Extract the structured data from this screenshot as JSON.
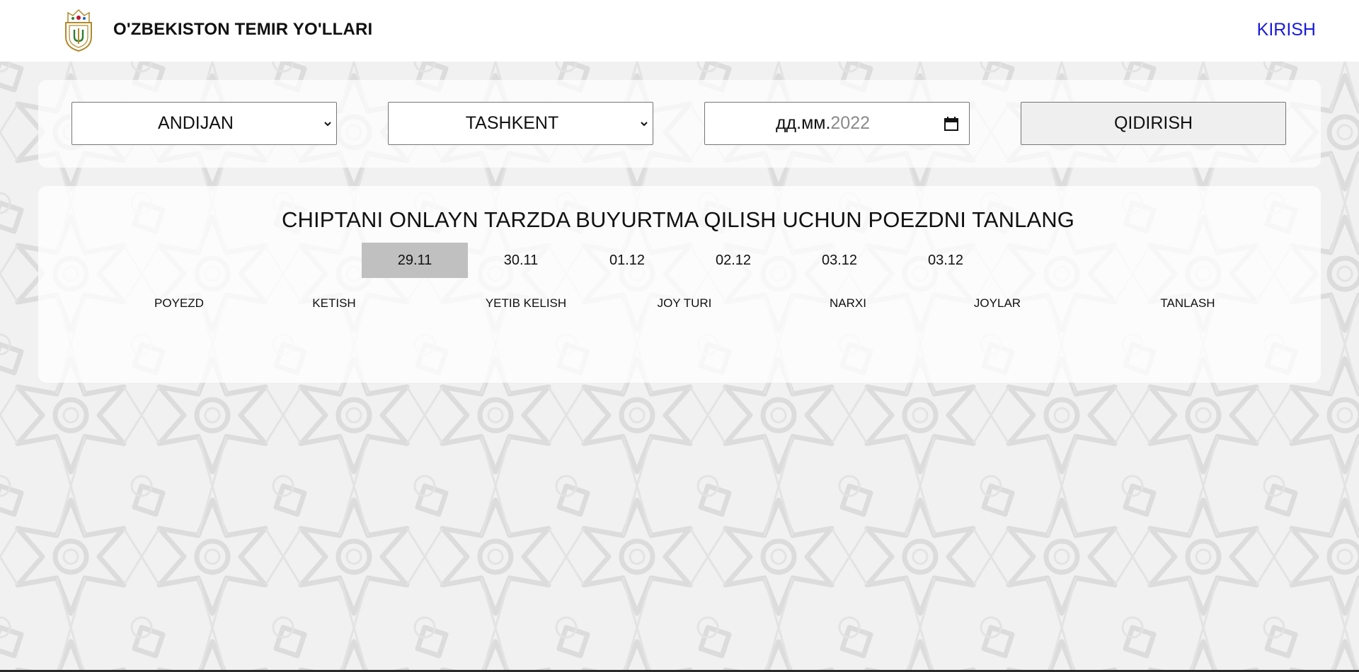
{
  "header": {
    "brand": "O'ZBEKISTON TEMIR YO'LLARI",
    "login_label": "KIRISH",
    "logo_icon": "railway-emblem-icon"
  },
  "search": {
    "from_station": "ANDIJAN",
    "to_station": "TASHKENT",
    "date_placeholder": "дд.мм.",
    "date_year": "2022",
    "search_label": "QIDIRISH"
  },
  "results": {
    "title": "CHIPTANI ONLAYN TARZDA BUYURTMA QILISH UCHUN POEZDNI TANLANG",
    "dates": [
      "29.11",
      "30.11",
      "01.12",
      "02.12",
      "03.12",
      "03.12"
    ],
    "active_date_index": 0,
    "columns": [
      "POYEZD",
      "KETISH",
      "YETIB KELISH",
      "JOY TURI",
      "NARXI",
      "JOYLAR",
      "TANLASH"
    ]
  },
  "colors": {
    "link": "#1a1adb",
    "active_date_bg": "#c0c0c0",
    "pattern_bg": "#f1f1f1"
  }
}
